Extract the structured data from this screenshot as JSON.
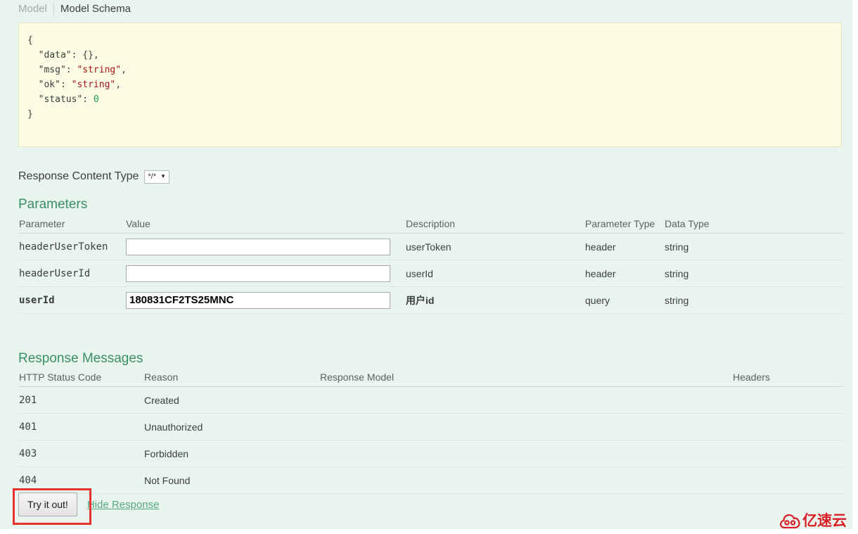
{
  "model_tabs": [
    {
      "label": "Model",
      "active": false
    },
    {
      "label": "Model Schema",
      "active": true
    }
  ],
  "schema": {
    "code": "{\n  \"data\": {},\n  \"msg\": \"string\",\n  \"ok\": \"string\",\n  \"status\": 0\n}",
    "lines": [
      "{",
      "  \"data\": {},",
      "  \"msg\": \"string\",",
      "  \"ok\": \"string\",",
      "  \"status\": 0",
      "}"
    ],
    "background_color": "#fcfbe3"
  },
  "response_content_type": {
    "label": "Response Content Type",
    "selected": "*/*",
    "options": [
      "*/*"
    ]
  },
  "parameters_section": {
    "heading": "Parameters",
    "columns": [
      "Parameter",
      "Value",
      "Description",
      "Parameter Type",
      "Data Type"
    ],
    "rows": [
      {
        "name": "headerUserToken",
        "required": false,
        "value": "",
        "placeholder": "",
        "description": "userToken",
        "description_bold": false,
        "parameter_type": "header",
        "data_type": "string"
      },
      {
        "name": "headerUserId",
        "required": false,
        "value": "",
        "placeholder": "",
        "description": "userId",
        "description_bold": false,
        "parameter_type": "header",
        "data_type": "string"
      },
      {
        "name": "userId",
        "required": true,
        "value": "180831CF2TS25MNC",
        "placeholder": "",
        "description": "用户id",
        "description_bold": true,
        "parameter_type": "query",
        "data_type": "string"
      }
    ]
  },
  "response_messages_section": {
    "heading": "Response Messages",
    "columns": [
      "HTTP Status Code",
      "Reason",
      "Response Model",
      "Headers"
    ],
    "rows": [
      {
        "code": "201",
        "reason": "Created",
        "response_model": "",
        "headers": ""
      },
      {
        "code": "401",
        "reason": "Unauthorized",
        "response_model": "",
        "headers": ""
      },
      {
        "code": "403",
        "reason": "Forbidden",
        "response_model": "",
        "headers": ""
      },
      {
        "code": "404",
        "reason": "Not Found",
        "response_model": "",
        "headers": ""
      }
    ]
  },
  "actions": {
    "try_it_out": "Try it out!",
    "hide_response": "Hide Response",
    "highlight_color": "#e8312f"
  },
  "watermark": {
    "text": "亿速云",
    "color": "#d81f26"
  },
  "theme": {
    "page_background": "#eaf4ef",
    "heading_green": "#3b8e68",
    "link_green": "#55a97f"
  }
}
